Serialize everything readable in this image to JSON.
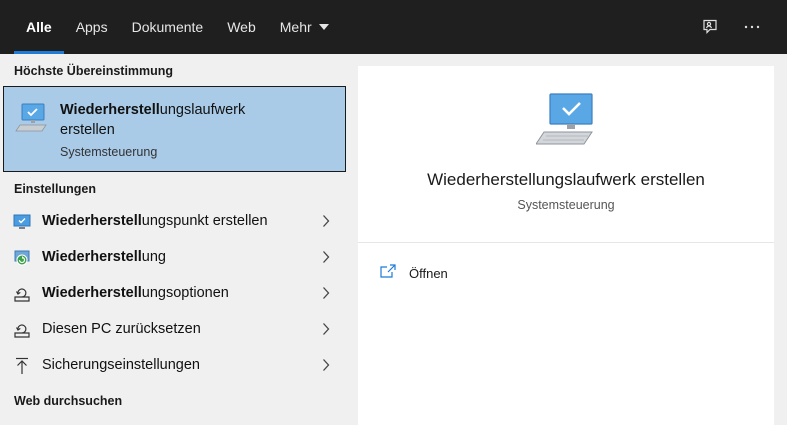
{
  "tabs": [
    {
      "label": "Alle",
      "active": true
    },
    {
      "label": "Apps",
      "active": false
    },
    {
      "label": "Dokumente",
      "active": false
    },
    {
      "label": "Web",
      "active": false
    },
    {
      "label": "Mehr",
      "active": false
    }
  ],
  "top_icons": [
    "feedback-icon",
    "more-options-icon"
  ],
  "sections": {
    "best_match": "Höchste Übereinstimmung",
    "settings": "Einstellungen",
    "web": "Web durchsuchen"
  },
  "best_match": {
    "title_bold": "Wiederherstell",
    "title_rest": "ungslaufwerk erstellen",
    "subtitle": "Systemsteuerung",
    "icon": "computer-check-icon"
  },
  "settings_items": [
    {
      "bold": "Wiederherstell",
      "rest": "ungspunkt erstellen",
      "icon": "restore-point-icon"
    },
    {
      "bold": "Wiederherstell",
      "rest": "ung",
      "icon": "recovery-icon"
    },
    {
      "bold": "Wiederherstell",
      "rest": "ungsoptionen",
      "icon": "recovery-options-icon"
    },
    {
      "bold": "",
      "rest": "Diesen PC zurücksetzen",
      "icon": "reset-pc-icon"
    },
    {
      "bold": "",
      "rest": "Sicherungseinstellungen",
      "icon": "backup-icon"
    }
  ],
  "preview": {
    "title": "Wiederherstellungslaufwerk erstellen",
    "subtitle": "Systemsteuerung",
    "action_label": "Öffnen",
    "icon": "computer-check-icon"
  },
  "colors": {
    "accent": "#1e7bd6",
    "topbar": "#1f1f1f",
    "selected": "#a9cbe8"
  }
}
